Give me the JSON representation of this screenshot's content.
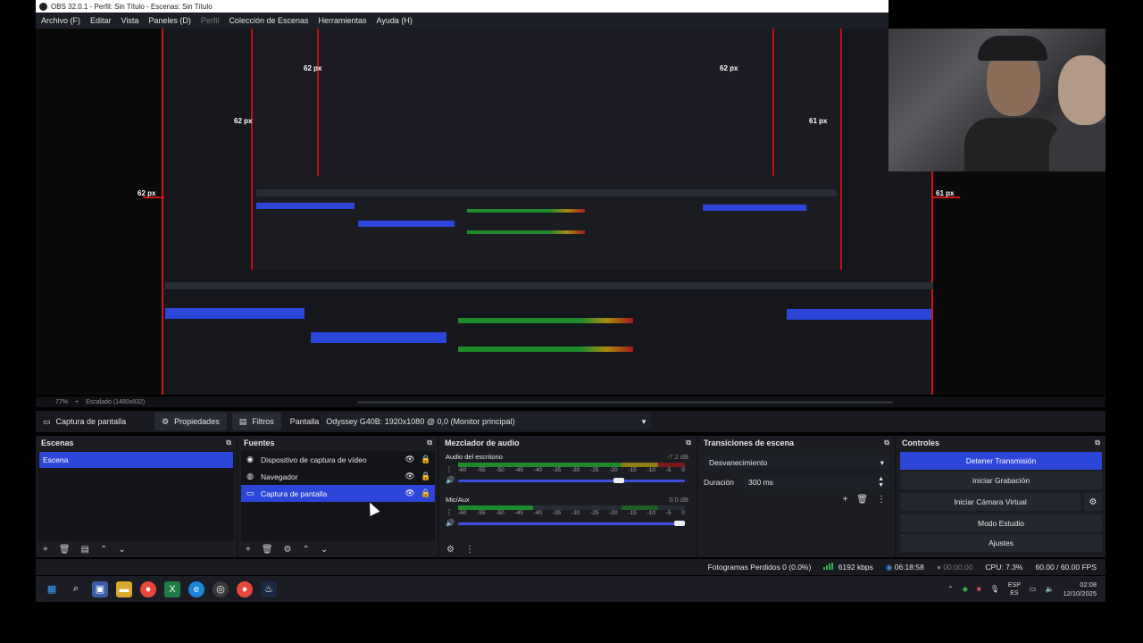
{
  "window": {
    "title": "OBS 32.0.1 - Perfil: Sin Título - Escenas: Sin Título"
  },
  "menu": [
    "Archivo (F)",
    "Editar",
    "Vista",
    "Paneles (D)",
    "Perfil",
    "Colección de Escenas",
    "Herramientas",
    "Ayuda (H)"
  ],
  "preview": {
    "labels": [
      "62 px",
      "62 px",
      "62 px",
      "61 px",
      "61 px",
      "62 px"
    ],
    "zoom_text": "77%",
    "scale_text": "Escalado (1480x832)"
  },
  "context": {
    "source_label": "Captura de pantalla",
    "properties": "Propiedades",
    "filters": "Filtros",
    "display_label": "Pantalla",
    "display_value": "Odyssey G40B: 1920x1080 @ 0,0 (Monitor principal)"
  },
  "scenes": {
    "title": "Escenas",
    "items": [
      "Escena"
    ]
  },
  "sources": {
    "title": "Fuentes",
    "items": [
      {
        "label": "Dispositivo de captura de vídeo",
        "selected": false
      },
      {
        "label": "Navegador",
        "selected": false
      },
      {
        "label": "Captura de pantalla",
        "selected": true
      }
    ]
  },
  "mixer": {
    "title": "Mezclador de audio",
    "channels": [
      {
        "name": "Audio del escritorio",
        "db": "-7.2 dB",
        "level": 0.88,
        "volume": 0.72
      },
      {
        "name": "Mic/Aux",
        "db": "0.0 dB",
        "level": 0.33,
        "volume": 1.0
      }
    ],
    "ticks": [
      "-60",
      "-55",
      "-50",
      "-45",
      "-40",
      "-35",
      "-30",
      "-25",
      "-20",
      "-15",
      "-10",
      "-5",
      "0"
    ]
  },
  "transitions": {
    "title": "Transiciones de escena",
    "type": "Desvanecimiento",
    "duration_label": "Duración",
    "duration_value": "300 ms"
  },
  "controls": {
    "title": "Controles",
    "stop_stream": "Detener Transmisión",
    "start_recording": "Iniciar Grabación",
    "virtual_cam": "Iniciar Cámara Virtual",
    "studio_mode": "Modo Estudio",
    "settings": "Ajustes"
  },
  "status": {
    "dropped": "Fotogramas Perdidos 0 (0.0%)",
    "bitrate": "6192 kbps",
    "stream_time": "06:18:58",
    "rec_time": "00:00:00",
    "cpu": "CPU: 7.3%",
    "fps": "60.00 / 60.00 FPS"
  },
  "taskbar": {
    "lang_top": "ESP",
    "lang_bottom": "ES",
    "time": "02:08",
    "date": "12/10/2025"
  },
  "colors": {
    "accent": "#2b46d8",
    "guide_red": "#d21414",
    "meter_green": "#1f8a2a"
  }
}
